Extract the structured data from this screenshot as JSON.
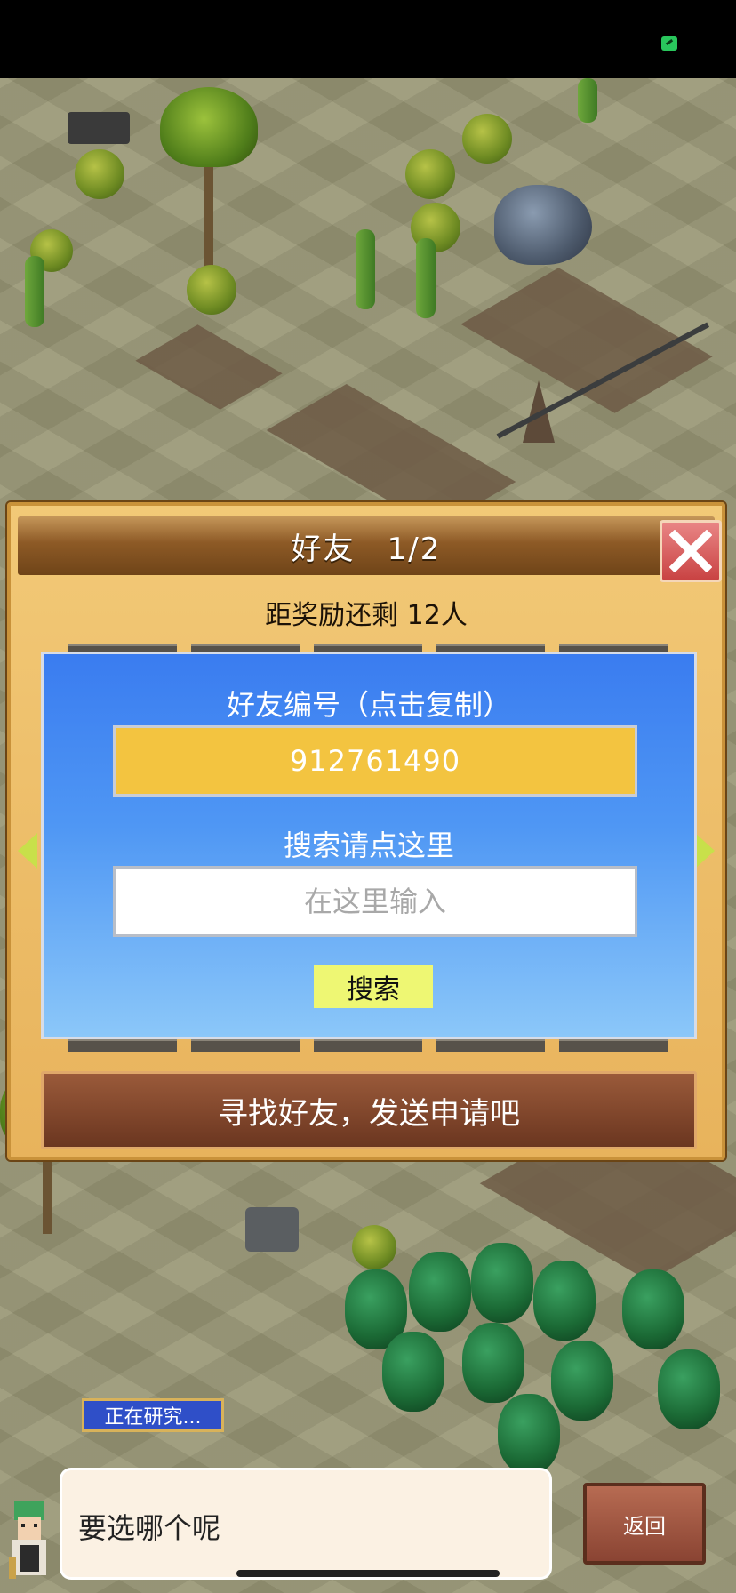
{
  "dialog": {
    "title": "好友　1/2",
    "reward_text": "距奖励还剩 12人",
    "friend_id_label": "好友编号（点击复制）",
    "friend_id": "912761490",
    "search_label": "搜索请点这里",
    "search_placeholder": "在这里输入",
    "search_button": "搜索",
    "find_friends_button": "寻找好友，发送申请吧"
  },
  "hud": {
    "research_badge": "正在研究...",
    "message": "要选哪个呢",
    "back_button": "返回"
  },
  "colors": {
    "panel_blue": "#3a7cf0",
    "friend_id_yellow": "#f3c440",
    "search_button_yellow": "#eef773",
    "close_red": "#c94343"
  },
  "icons": [
    "close-icon",
    "arrow-left-icon",
    "arrow-right-icon",
    "battery-icon"
  ]
}
